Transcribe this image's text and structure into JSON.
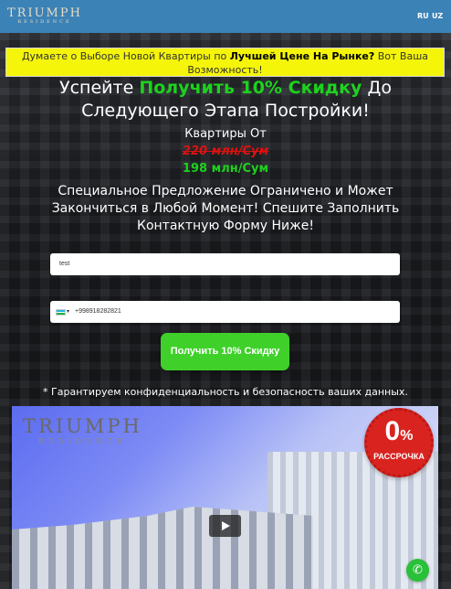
{
  "header": {
    "logo_main": "TRIUMPH",
    "logo_sub": "RESIDENCE",
    "lang_ru": "RU",
    "lang_uz": "UZ"
  },
  "hero": {
    "banner_prefix": "Думаете о Выборе Новой Квартиры по ",
    "banner_bold": "Лучшей Цене На Рынке?",
    "banner_suffix": " Вот Ваша Возможность!",
    "headline_before": "Успейте ",
    "headline_highlight": "Получить 10% Скидку",
    "headline_after": " До Следующего Этапа Постройки!",
    "price_label": "Квартиры От",
    "price_old": "220 млн/Сум",
    "price_new": "198 млн/Сум",
    "offer_text": "Специальное Предложение Ограничено и Может Закончиться в Любой Момент! Спешите Заполнить Контактную Форму Ниже!"
  },
  "form": {
    "name_value": "test",
    "phone_caret": "▾",
    "phone_value": "+998918282821",
    "submit_label": "Получить 10% Скидку",
    "guarantee": "* Гарантируем конфиденциальность и безопасность ваших данных."
  },
  "video": {
    "logo_main": "TRIUMPH",
    "logo_sub": "RESIDENCE",
    "seal_number": "0",
    "seal_percent": "%",
    "seal_text": "РАССРОЧКА"
  },
  "colors": {
    "header_bg": "#3b82b6",
    "banner_bg": "#f5f50a",
    "accent_green": "#1dd21d",
    "old_price_red": "#e01010",
    "cta_green": "#3fd12a",
    "seal_red": "#d9231f",
    "whatsapp_green": "#29c03a"
  },
  "icons": {
    "play": "play-icon",
    "whatsapp": "whatsapp-icon",
    "flag": "uzbekistan-flag-icon"
  }
}
